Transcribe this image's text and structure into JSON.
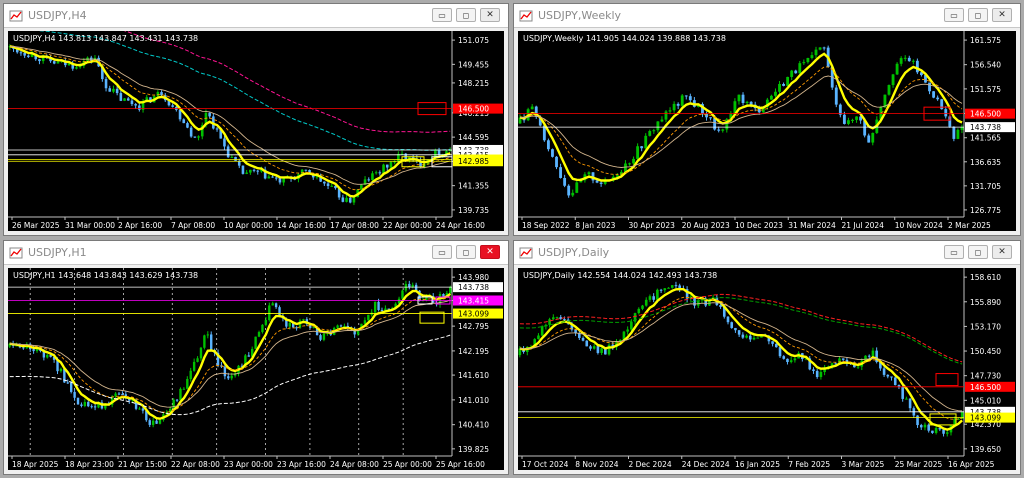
{
  "colors": {
    "background": "#000000",
    "bull_candle": "#00c000",
    "bear_candle": "#5ab4ff",
    "yellow_line": "#ffff00",
    "red_level": "#ff0000",
    "axis_text": "#ffffff",
    "close_button_active": "#e81123"
  },
  "window_buttons": {
    "minimize": "▭",
    "maximize": "◻",
    "close": "✕"
  },
  "windows": [
    {
      "title": "USDJPY,H4",
      "info": "USDJPY,H4  143.813 143.847 143.431 143.738",
      "active": false,
      "chart_data": {
        "type": "candlestick",
        "symbol": "USDJPY",
        "timeframe": "H4",
        "ohlc_last": {
          "open": 143.813,
          "high": 143.847,
          "low": 143.431,
          "close": 143.738
        },
        "y_ticks": [
          "151.075",
          "149.455",
          "148.215",
          "146.215",
          "144.595",
          "142.975",
          "141.355",
          "139.735"
        ],
        "ylim": [
          139.735,
          151.075
        ],
        "x_ticks": [
          "26 Mar 2025",
          "31 Mar 00:00",
          "2 Apr 16:00",
          "7 Apr 08:00",
          "10 Apr 00:00",
          "14 Apr 16:00",
          "17 Apr 08:00",
          "22 Apr 00:00",
          "24 Apr 16:00"
        ],
        "price_labels": [
          {
            "text": "146.500",
            "value": 146.5,
            "color": "#ff0000"
          },
          {
            "text": "143.738",
            "value": 143.738,
            "color": "#ffffff"
          },
          {
            "text": "143.415",
            "value": 143.415,
            "color": "#ffffff"
          },
          {
            "text": "143.099",
            "value": 143.099,
            "color": "#ffff00"
          },
          {
            "text": "142.985",
            "value": 142.985,
            "color": "#ffff00"
          }
        ],
        "path": [
          [
            0,
            150.6
          ],
          [
            0.05,
            150.2
          ],
          [
            0.1,
            149.6
          ],
          [
            0.15,
            149.4
          ],
          [
            0.2,
            149.9
          ],
          [
            0.22,
            148.2
          ],
          [
            0.26,
            147.1
          ],
          [
            0.3,
            146.7
          ],
          [
            0.35,
            147.6
          ],
          [
            0.4,
            145.7
          ],
          [
            0.43,
            144.2
          ],
          [
            0.45,
            146.4
          ],
          [
            0.5,
            143.5
          ],
          [
            0.53,
            142.2
          ],
          [
            0.57,
            142.2
          ],
          [
            0.62,
            141.6
          ],
          [
            0.68,
            142.3
          ],
          [
            0.73,
            141.2
          ],
          [
            0.77,
            140.2
          ],
          [
            0.81,
            141.7
          ],
          [
            0.85,
            142.5
          ],
          [
            0.89,
            143.4
          ],
          [
            0.93,
            142.8
          ],
          [
            0.97,
            143.6
          ],
          [
            1,
            143.74
          ]
        ]
      }
    },
    {
      "title": "USDJPY,Weekly",
      "info": "USDJPY,Weekly  141.905 144.024 139.888 143.738",
      "active": false,
      "chart_data": {
        "type": "candlestick",
        "symbol": "USDJPY",
        "timeframe": "Weekly",
        "ohlc_last": {
          "open": 141.905,
          "high": 144.024,
          "low": 139.888,
          "close": 143.738
        },
        "y_ticks": [
          "161.575",
          "156.540",
          "151.575",
          "146.540",
          "141.565",
          "136.635",
          "131.705",
          "126.775"
        ],
        "ylim": [
          126.775,
          161.575
        ],
        "x_ticks": [
          "18 Sep 2022",
          "8 Jan 2023",
          "30 Apr 2023",
          "20 Aug 2023",
          "10 Dec 2023",
          "31 Mar 2024",
          "21 Jul 2024",
          "10 Nov 2024",
          "2 Mar 2025"
        ],
        "price_labels": [
          {
            "text": "146.500",
            "value": 146.5,
            "color": "#ff0000"
          },
          {
            "text": "143.738",
            "value": 143.738,
            "color": "#ffffff"
          }
        ],
        "path": [
          [
            0,
            144.5
          ],
          [
            0.04,
            147.5
          ],
          [
            0.08,
            138
          ],
          [
            0.12,
            130
          ],
          [
            0.16,
            134
          ],
          [
            0.2,
            132
          ],
          [
            0.26,
            137.5
          ],
          [
            0.32,
            145
          ],
          [
            0.38,
            150
          ],
          [
            0.42,
            147
          ],
          [
            0.46,
            142
          ],
          [
            0.5,
            150
          ],
          [
            0.54,
            147
          ],
          [
            0.58,
            151
          ],
          [
            0.62,
            155
          ],
          [
            0.66,
            157.5
          ],
          [
            0.69,
            160.5
          ],
          [
            0.71,
            151
          ],
          [
            0.74,
            144
          ],
          [
            0.77,
            146.5
          ],
          [
            0.79,
            140
          ],
          [
            0.82,
            149
          ],
          [
            0.85,
            156.5
          ],
          [
            0.88,
            158
          ],
          [
            0.91,
            154
          ],
          [
            0.94,
            150
          ],
          [
            0.96,
            146.5
          ],
          [
            0.98,
            141
          ],
          [
            1,
            143.74
          ]
        ]
      }
    },
    {
      "title": "USDJPY,H1",
      "info": "USDJPY,H1  143.648 143.843 143.629 143.738",
      "active": true,
      "chart_data": {
        "type": "candlestick",
        "symbol": "USDJPY",
        "timeframe": "H1",
        "ohlc_last": {
          "open": 143.648,
          "high": 143.843,
          "low": 143.629,
          "close": 143.738
        },
        "y_ticks": [
          "143.980",
          "143.415",
          "142.795",
          "142.195",
          "141.610",
          "141.010",
          "140.410",
          "139.825"
        ],
        "ylim": [
          139.825,
          143.98
        ],
        "x_ticks": [
          "18 Apr 2025",
          "18 Apr 23:00",
          "21 Apr 15:00",
          "22 Apr 08:00",
          "23 Apr 00:00",
          "23 Apr 16:00",
          "24 Apr 08:00",
          "25 Apr 00:00",
          "25 Apr 16:00"
        ],
        "price_labels": [
          {
            "text": "143.738",
            "value": 143.738,
            "color": "#ffffff"
          },
          {
            "text": "143.415",
            "value": 143.415,
            "color": "#ff00ff"
          },
          {
            "text": "143.099",
            "value": 143.099,
            "color": "#ffff00"
          }
        ],
        "path": [
          [
            0,
            142.3
          ],
          [
            0.06,
            142.25
          ],
          [
            0.11,
            141.9
          ],
          [
            0.16,
            141.0
          ],
          [
            0.2,
            140.8
          ],
          [
            0.25,
            141.1
          ],
          [
            0.29,
            140.9
          ],
          [
            0.33,
            140.4
          ],
          [
            0.37,
            140.8
          ],
          [
            0.41,
            141.5
          ],
          [
            0.45,
            142.6
          ],
          [
            0.49,
            141.6
          ],
          [
            0.52,
            141.7
          ],
          [
            0.56,
            142.4
          ],
          [
            0.6,
            143.4
          ],
          [
            0.63,
            142.8
          ],
          [
            0.67,
            142.9
          ],
          [
            0.71,
            142.5
          ],
          [
            0.75,
            142.8
          ],
          [
            0.79,
            142.6
          ],
          [
            0.83,
            143.3
          ],
          [
            0.87,
            143.2
          ],
          [
            0.9,
            143.9
          ],
          [
            0.93,
            143.5
          ],
          [
            0.97,
            143.4
          ],
          [
            1,
            143.74
          ]
        ]
      }
    },
    {
      "title": "USDJPY,Daily",
      "info": "USDJPY,Daily  142.554 144.024 142.493 143.738",
      "active": false,
      "chart_data": {
        "type": "candlestick",
        "symbol": "USDJPY",
        "timeframe": "Daily",
        "ohlc_last": {
          "open": 142.554,
          "high": 144.024,
          "low": 142.493,
          "close": 143.738
        },
        "y_ticks": [
          "158.610",
          "155.890",
          "153.170",
          "150.450",
          "147.730",
          "145.010",
          "142.370",
          "139.650"
        ],
        "ylim": [
          139.65,
          158.61
        ],
        "x_ticks": [
          "17 Oct 2024",
          "8 Nov 2024",
          "2 Dec 2024",
          "24 Dec 2024",
          "16 Jan 2025",
          "7 Feb 2025",
          "3 Mar 2025",
          "25 Mar 2025",
          "16 Apr 2025"
        ],
        "price_labels": [
          {
            "text": "146.500",
            "value": 146.5,
            "color": "#ff0000"
          },
          {
            "text": "143.738",
            "value": 143.738,
            "color": "#ffffff"
          },
          {
            "text": "143.099",
            "value": 143.099,
            "color": "#ffff00"
          }
        ],
        "path": [
          [
            0,
            150
          ],
          [
            0.04,
            151.5
          ],
          [
            0.08,
            154.5
          ],
          [
            0.12,
            153.5
          ],
          [
            0.16,
            151
          ],
          [
            0.2,
            150.2
          ],
          [
            0.24,
            152.5
          ],
          [
            0.28,
            155
          ],
          [
            0.32,
            157.2
          ],
          [
            0.36,
            157.8
          ],
          [
            0.4,
            155.8
          ],
          [
            0.44,
            156
          ],
          [
            0.48,
            153.6
          ],
          [
            0.52,
            151.8
          ],
          [
            0.56,
            152.5
          ],
          [
            0.6,
            149.5
          ],
          [
            0.64,
            150
          ],
          [
            0.68,
            147.6
          ],
          [
            0.72,
            149.3
          ],
          [
            0.76,
            148.6
          ],
          [
            0.8,
            150.3
          ],
          [
            0.83,
            147.6
          ],
          [
            0.86,
            146.2
          ],
          [
            0.88,
            144.5
          ],
          [
            0.9,
            142.5
          ],
          [
            0.93,
            141.8
          ],
          [
            0.96,
            141.2
          ],
          [
            1,
            143.74
          ]
        ]
      }
    }
  ]
}
